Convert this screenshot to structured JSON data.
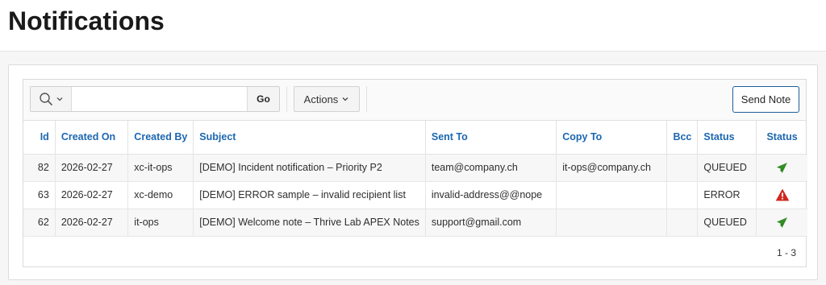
{
  "page": {
    "title": "Notifications"
  },
  "toolbar": {
    "search_icon": "search-icon",
    "search_value": "",
    "go_label": "Go",
    "actions_label": "Actions",
    "send_note_label": "Send Note"
  },
  "table": {
    "columns": [
      "Id",
      "Created On",
      "Created By",
      "Subject",
      "Sent To",
      "Copy To",
      "Bcc",
      "Status",
      "Status"
    ],
    "rows": [
      {
        "id": "82",
        "created_on": "2026-02-27",
        "created_by": "xc-it-ops",
        "subject": "[DEMO] Incident notification – Priority P2",
        "sent_to": "team@company.ch",
        "copy_to": "it-ops@company.ch",
        "bcc": "",
        "status": "QUEUED",
        "status_icon": "send-icon",
        "status_color": "#2e8b1f"
      },
      {
        "id": "63",
        "created_on": "2026-02-27",
        "created_by": "xc-demo",
        "subject": "[DEMO] ERROR sample – invalid recipient list",
        "sent_to": "invalid-address@@nope",
        "copy_to": "",
        "bcc": "",
        "status": "ERROR",
        "status_icon": "warning-icon",
        "status_color": "#d0281e"
      },
      {
        "id": "62",
        "created_on": "2026-02-27",
        "created_by": "it-ops",
        "subject": "[DEMO] Welcome note – Thrive Lab APEX Notes",
        "sent_to": "support@gmail.com",
        "copy_to": "",
        "bcc": "",
        "status": "QUEUED",
        "status_icon": "send-icon",
        "status_color": "#2e8b1f"
      }
    ]
  },
  "pagination": {
    "label": "1 - 3"
  }
}
